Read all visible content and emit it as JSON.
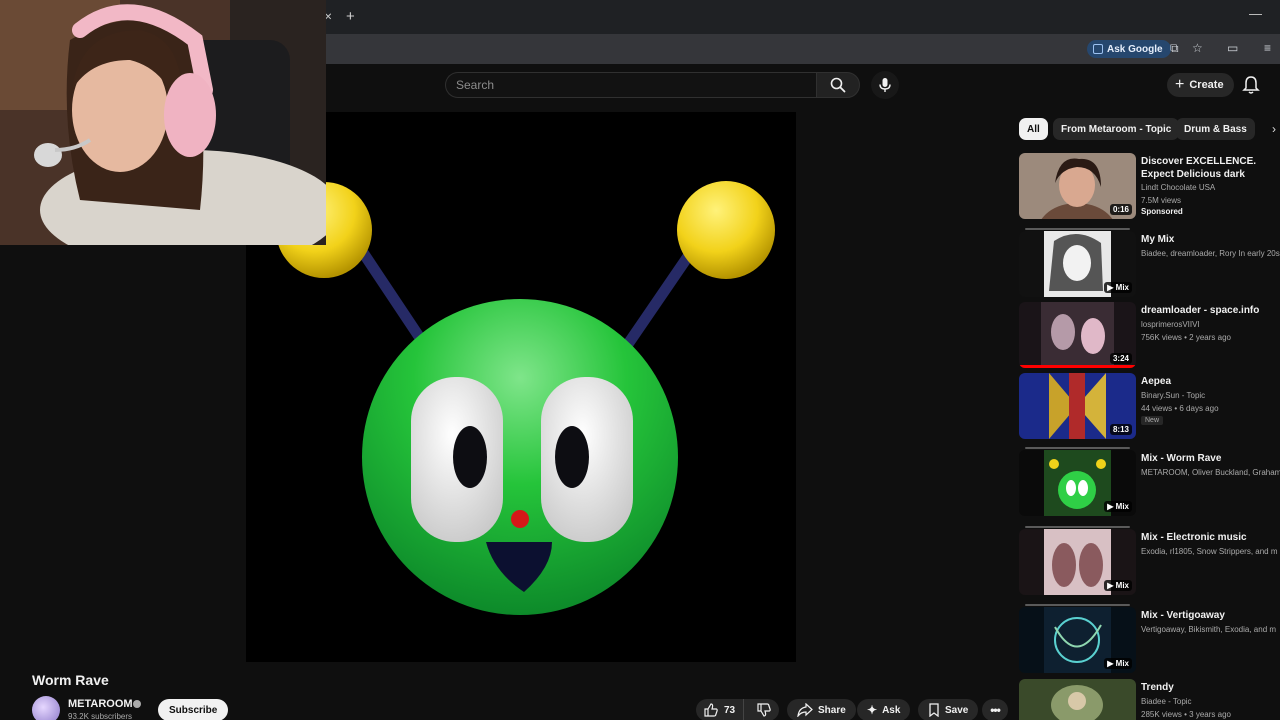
{
  "browser": {
    "tab_close_icon": "close-icon",
    "new_tab_icon": "plus-icon",
    "minimize_icon": "minimize-icon",
    "ask_google_label": "Ask Google"
  },
  "header": {
    "search_placeholder": "Search",
    "create_label": "Create"
  },
  "video": {
    "title": "Worm Rave",
    "channel_name": "METAROOM",
    "subscribers": "93.2K subscribers",
    "subscribe_label": "Subscribe",
    "like_count": "73",
    "share_label": "Share",
    "ask_label": "Ask",
    "save_label": "Save"
  },
  "chips": [
    {
      "label": "All",
      "active": true
    },
    {
      "label": "From Metaroom - Topic",
      "active": false
    },
    {
      "label": "Drum & Bass",
      "active": false
    }
  ],
  "recommendations": [
    {
      "title": "Discover EXCELLENCE. Expect Delicious dark chocolate by th...",
      "channel": "Lindt Chocolate USA",
      "meta": "7.5M views",
      "badge": "Sponsored",
      "duration": "0:16"
    },
    {
      "title": "My Mix",
      "channel": "Biadee, dreamloader, Rory In early 20s",
      "meta": "",
      "badge": "",
      "duration": "Mix"
    },
    {
      "title": "dreamloader - space.info",
      "channel": "losprimerosVIIVI",
      "meta": "756K views • 2 years ago",
      "badge": "",
      "duration": "3:24"
    },
    {
      "title": "Aepea",
      "channel": "Binary.Sun - Topic",
      "meta": "44 views • 6 days ago",
      "badge": "New",
      "duration": "8:13"
    },
    {
      "title": "Mix - Worm Rave",
      "channel": "METAROOM, Oliver Buckland, Graham",
      "meta": "",
      "badge": "",
      "duration": "Mix"
    },
    {
      "title": "Mix - Electronic music",
      "channel": "Exodia, rl1805, Snow Strippers, and m",
      "meta": "",
      "badge": "",
      "duration": "Mix"
    },
    {
      "title": "Mix - Vertigoaway",
      "channel": "Vertigoaway, Bikismith, Exodia, and m",
      "meta": "",
      "badge": "",
      "duration": "Mix"
    },
    {
      "title": "Trendy",
      "channel": "Biadee - Topic",
      "meta": "285K views • 3 years ago",
      "badge": "",
      "duration": ""
    }
  ],
  "colors": {
    "accent_red": "#ff0000",
    "background": "#0f0f0f",
    "ask_google_bg": "#26476e"
  }
}
